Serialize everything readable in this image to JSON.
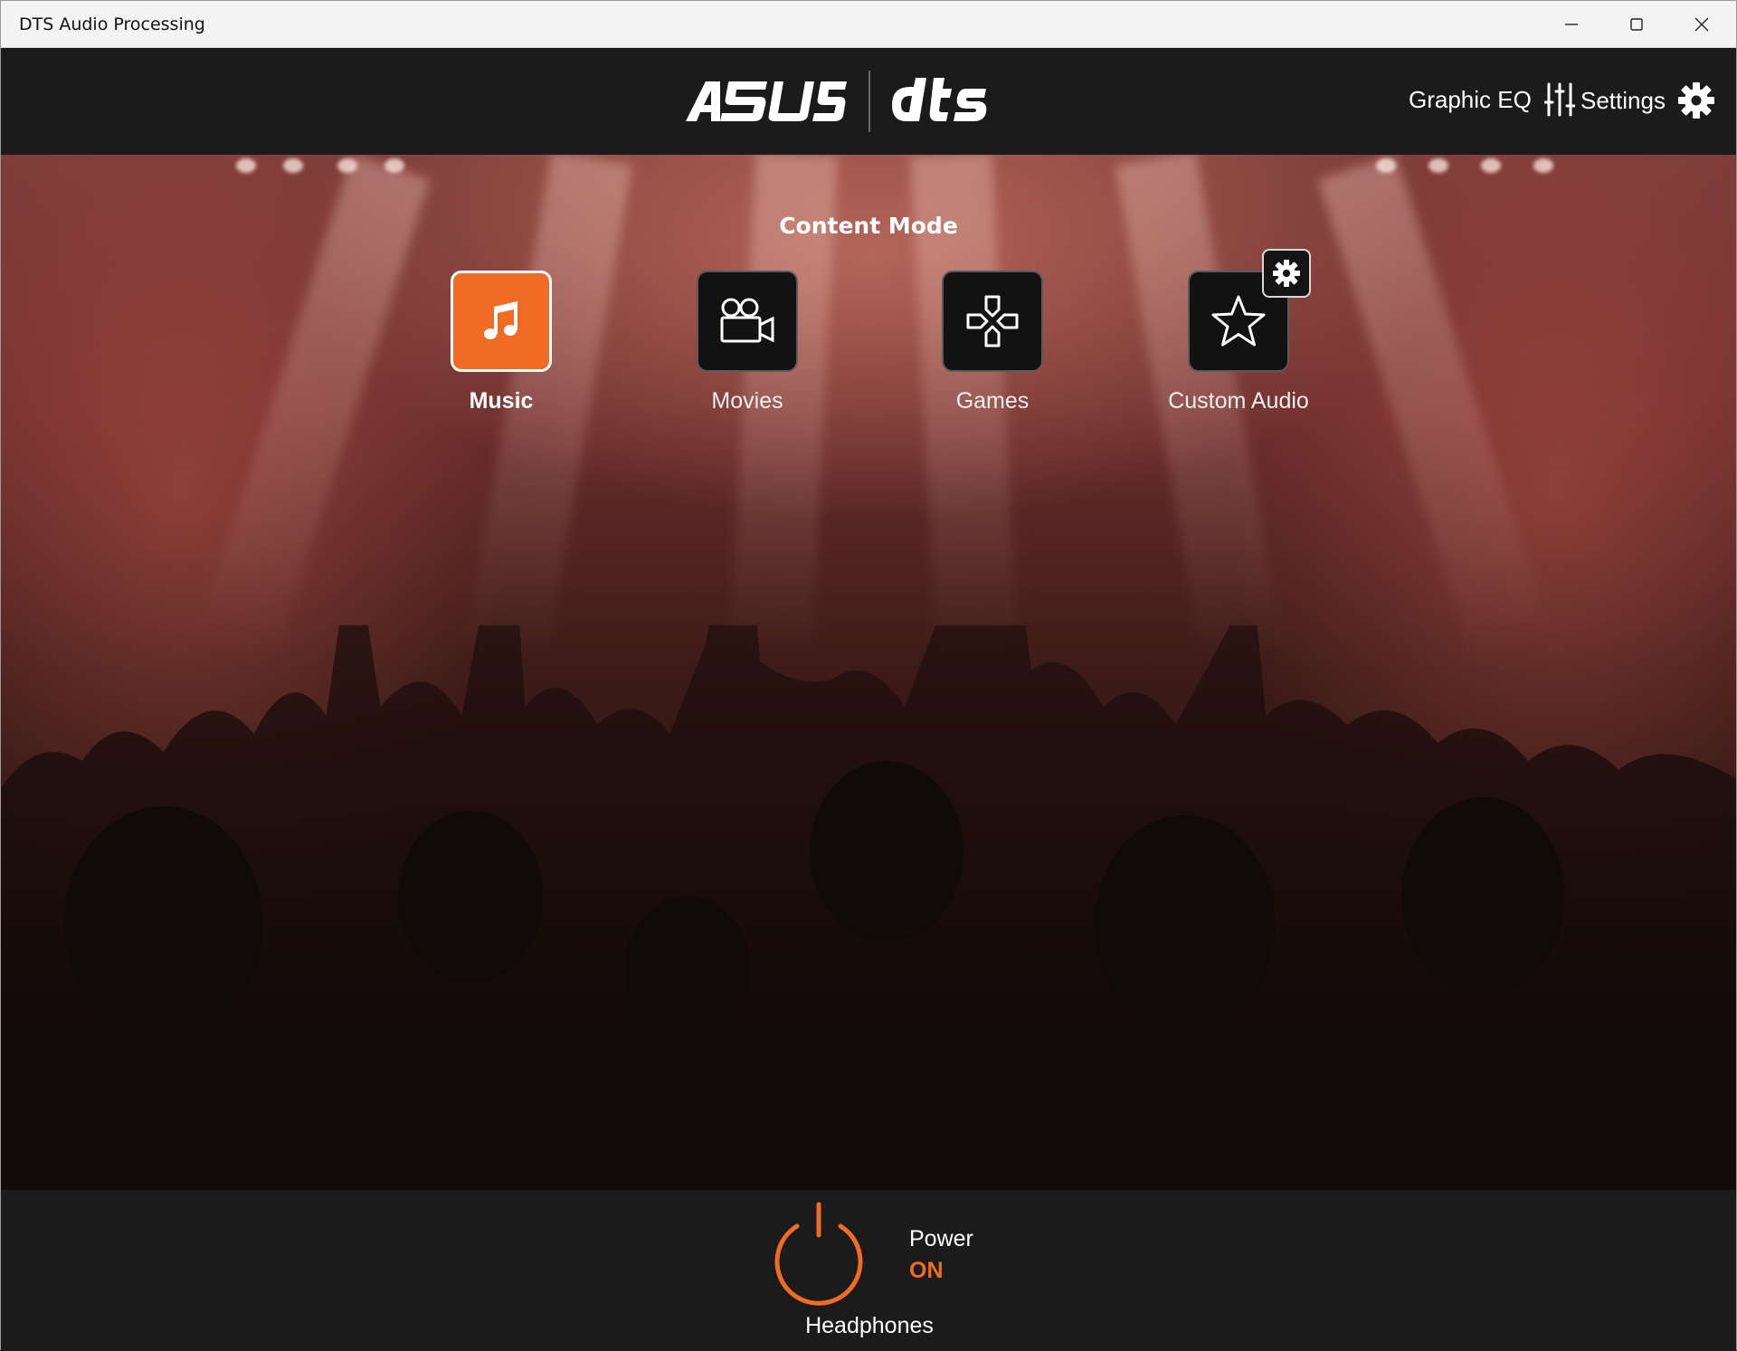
{
  "window": {
    "title": "DTS Audio Processing"
  },
  "header": {
    "brand_left": "/ISUS",
    "brand_right": "dts",
    "graphic_eq_label": "Graphic EQ",
    "settings_label": "Settings"
  },
  "content": {
    "heading": "Content Mode",
    "modes": [
      {
        "label": "Music",
        "icon": "music-note-icon",
        "active": true
      },
      {
        "label": "Movies",
        "icon": "movie-camera-icon",
        "active": false
      },
      {
        "label": "Games",
        "icon": "gamepad-icon",
        "active": false
      },
      {
        "label": "Custom Audio",
        "icon": "star-icon",
        "active": false
      }
    ]
  },
  "footer": {
    "power_label": "Power",
    "power_state": "ON",
    "device": "Headphones"
  },
  "colors": {
    "accent": "#f06b24",
    "bar": "#1b1b1b"
  }
}
